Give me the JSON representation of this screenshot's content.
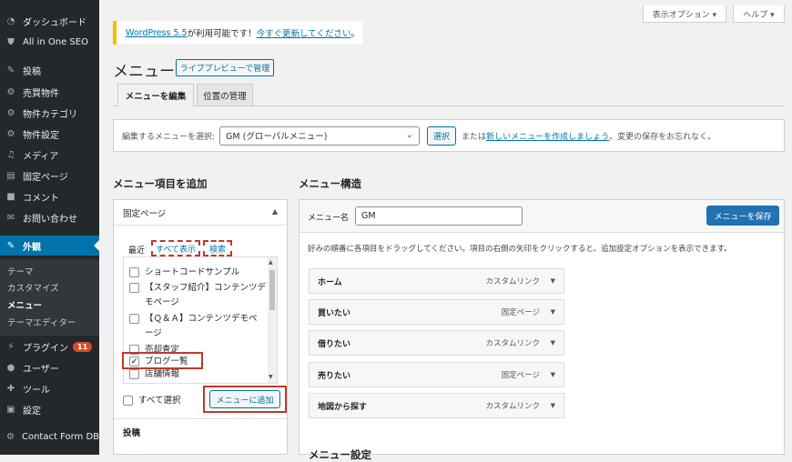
{
  "sidebar": {
    "items": [
      {
        "label": "ダッシュボード",
        "icon": "dashboard-icon"
      },
      {
        "label": "All in One SEO",
        "icon": "shield-icon"
      },
      {
        "label": "投稿",
        "icon": "pin-icon"
      },
      {
        "label": "売買物件",
        "icon": "gear-icon"
      },
      {
        "label": "物件カテゴリ",
        "icon": "gear-icon"
      },
      {
        "label": "物件設定",
        "icon": "gear-icon"
      },
      {
        "label": "メディア",
        "icon": "media-icon"
      },
      {
        "label": "固定ページ",
        "icon": "page-icon"
      },
      {
        "label": "コメント",
        "icon": "comment-icon"
      },
      {
        "label": "お問い合わせ",
        "icon": "mail-icon"
      },
      {
        "label": "外観",
        "icon": "brush-icon"
      },
      {
        "label": "プラグイン",
        "icon": "plugin-icon",
        "badge": "11"
      },
      {
        "label": "ユーザー",
        "icon": "user-icon"
      },
      {
        "label": "ツール",
        "icon": "wrench-icon"
      },
      {
        "label": "設定",
        "icon": "settings-icon"
      },
      {
        "label": "Contact Form DB",
        "icon": "gear-icon"
      }
    ],
    "appearance_sub": [
      "テーマ",
      "カスタマイズ",
      "メニュー",
      "テーマエディター"
    ]
  },
  "top_buttons": {
    "screen_options": "表示オプション ▾",
    "help": "ヘルプ ▾"
  },
  "notice": {
    "link1": "WordPress 5.5",
    "text": " が利用可能です！",
    "link2": "今すぐ更新してください",
    "end": "。"
  },
  "page": {
    "title": "メニュー",
    "live_preview": "ライブプレビューで管理"
  },
  "tabs": [
    "メニューを編集",
    "位置の管理"
  ],
  "select_bar": {
    "label": "編集するメニューを選択:",
    "selected": "GM (グローバルメニュー)",
    "button": "選択",
    "or": "または",
    "create_link": "新しいメニューを作成しましょう",
    "tail": "。変更の保存をお忘れなく。"
  },
  "left": {
    "heading": "メニュー項目を追加",
    "accordion": "固定ページ",
    "panel_tabs": [
      "最近",
      "すべて表示",
      "検索"
    ],
    "pages": [
      {
        "label": "ショートコードサンプル",
        "checked": false
      },
      {
        "label": "【スタッフ紹介】コンテンツデモページ",
        "checked": false
      },
      {
        "label": "【Ｑ＆Ａ】コンテンツデモページ",
        "checked": false
      },
      {
        "label": "売却査定",
        "checked": false
      },
      {
        "label": "ブログ一覧",
        "checked": true
      },
      {
        "label": "店舗情報",
        "checked": false
      }
    ],
    "select_all": "すべて選択",
    "add_button": "メニューに追加",
    "posts": "投稿"
  },
  "right": {
    "heading": "メニュー構造",
    "name_label": "メニュー名",
    "name_value": "GM",
    "save": "メニューを保存",
    "instructions": "好みの順番に各項目をドラッグしてください。項目の右側の矢印をクリックすると、追加設定オプションを表示できます。",
    "items": [
      {
        "title": "ホーム",
        "type": "カスタムリンク"
      },
      {
        "title": "買いたい",
        "type": "固定ページ"
      },
      {
        "title": "借りたい",
        "type": "カスタムリンク"
      },
      {
        "title": "売りたい",
        "type": "固定ページ"
      },
      {
        "title": "地図から探す",
        "type": "カスタムリンク"
      }
    ],
    "settings_heading": "メニュー設定"
  }
}
